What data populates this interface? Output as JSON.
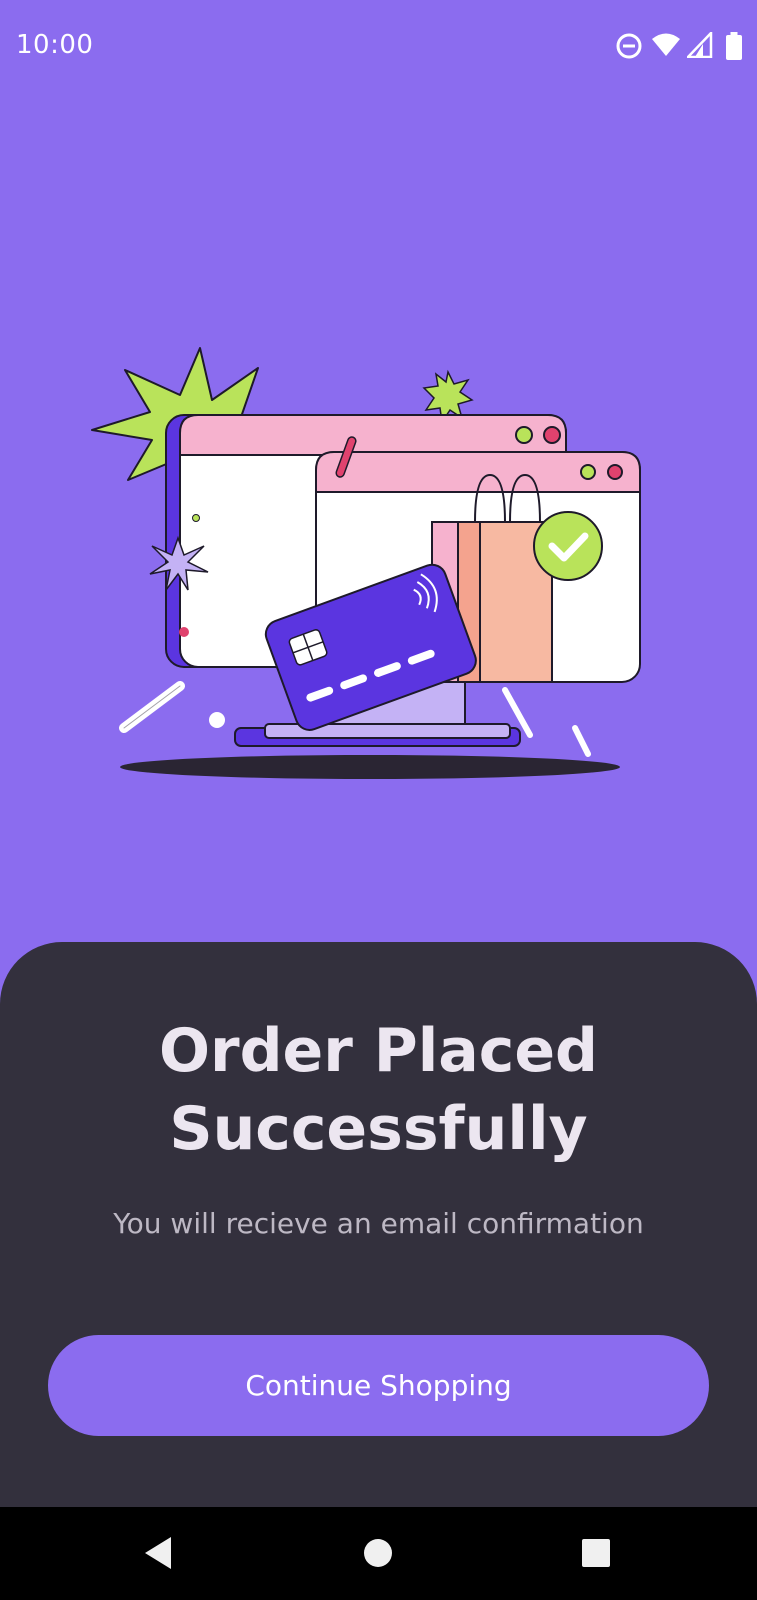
{
  "status_bar": {
    "time": "10:00",
    "icons": [
      "do-not-disturb-icon",
      "wifi-icon",
      "cellular-signal-icon",
      "battery-icon"
    ]
  },
  "hero": {
    "illustration": "order-success-illustration",
    "colors": {
      "accent_green": "#B9E35A",
      "window_pink": "#F6B2CE",
      "card_purple": "#5B35E0",
      "bag_peach": "#F7B9A2"
    }
  },
  "confirmation": {
    "title_line1": "Order Placed",
    "title_line2": "Successfully",
    "subtitle": "You will recieve an email confirmation",
    "continue_label": "Continue Shopping"
  },
  "nav_bar": {
    "buttons": [
      "back-icon",
      "home-icon",
      "recents-icon"
    ]
  },
  "colors": {
    "background": "#8B6CEF",
    "sheet": "#33303D",
    "button": "#8B6CEF",
    "title_text": "#ECE6F0",
    "subtitle_text": "#BDB8C4"
  }
}
